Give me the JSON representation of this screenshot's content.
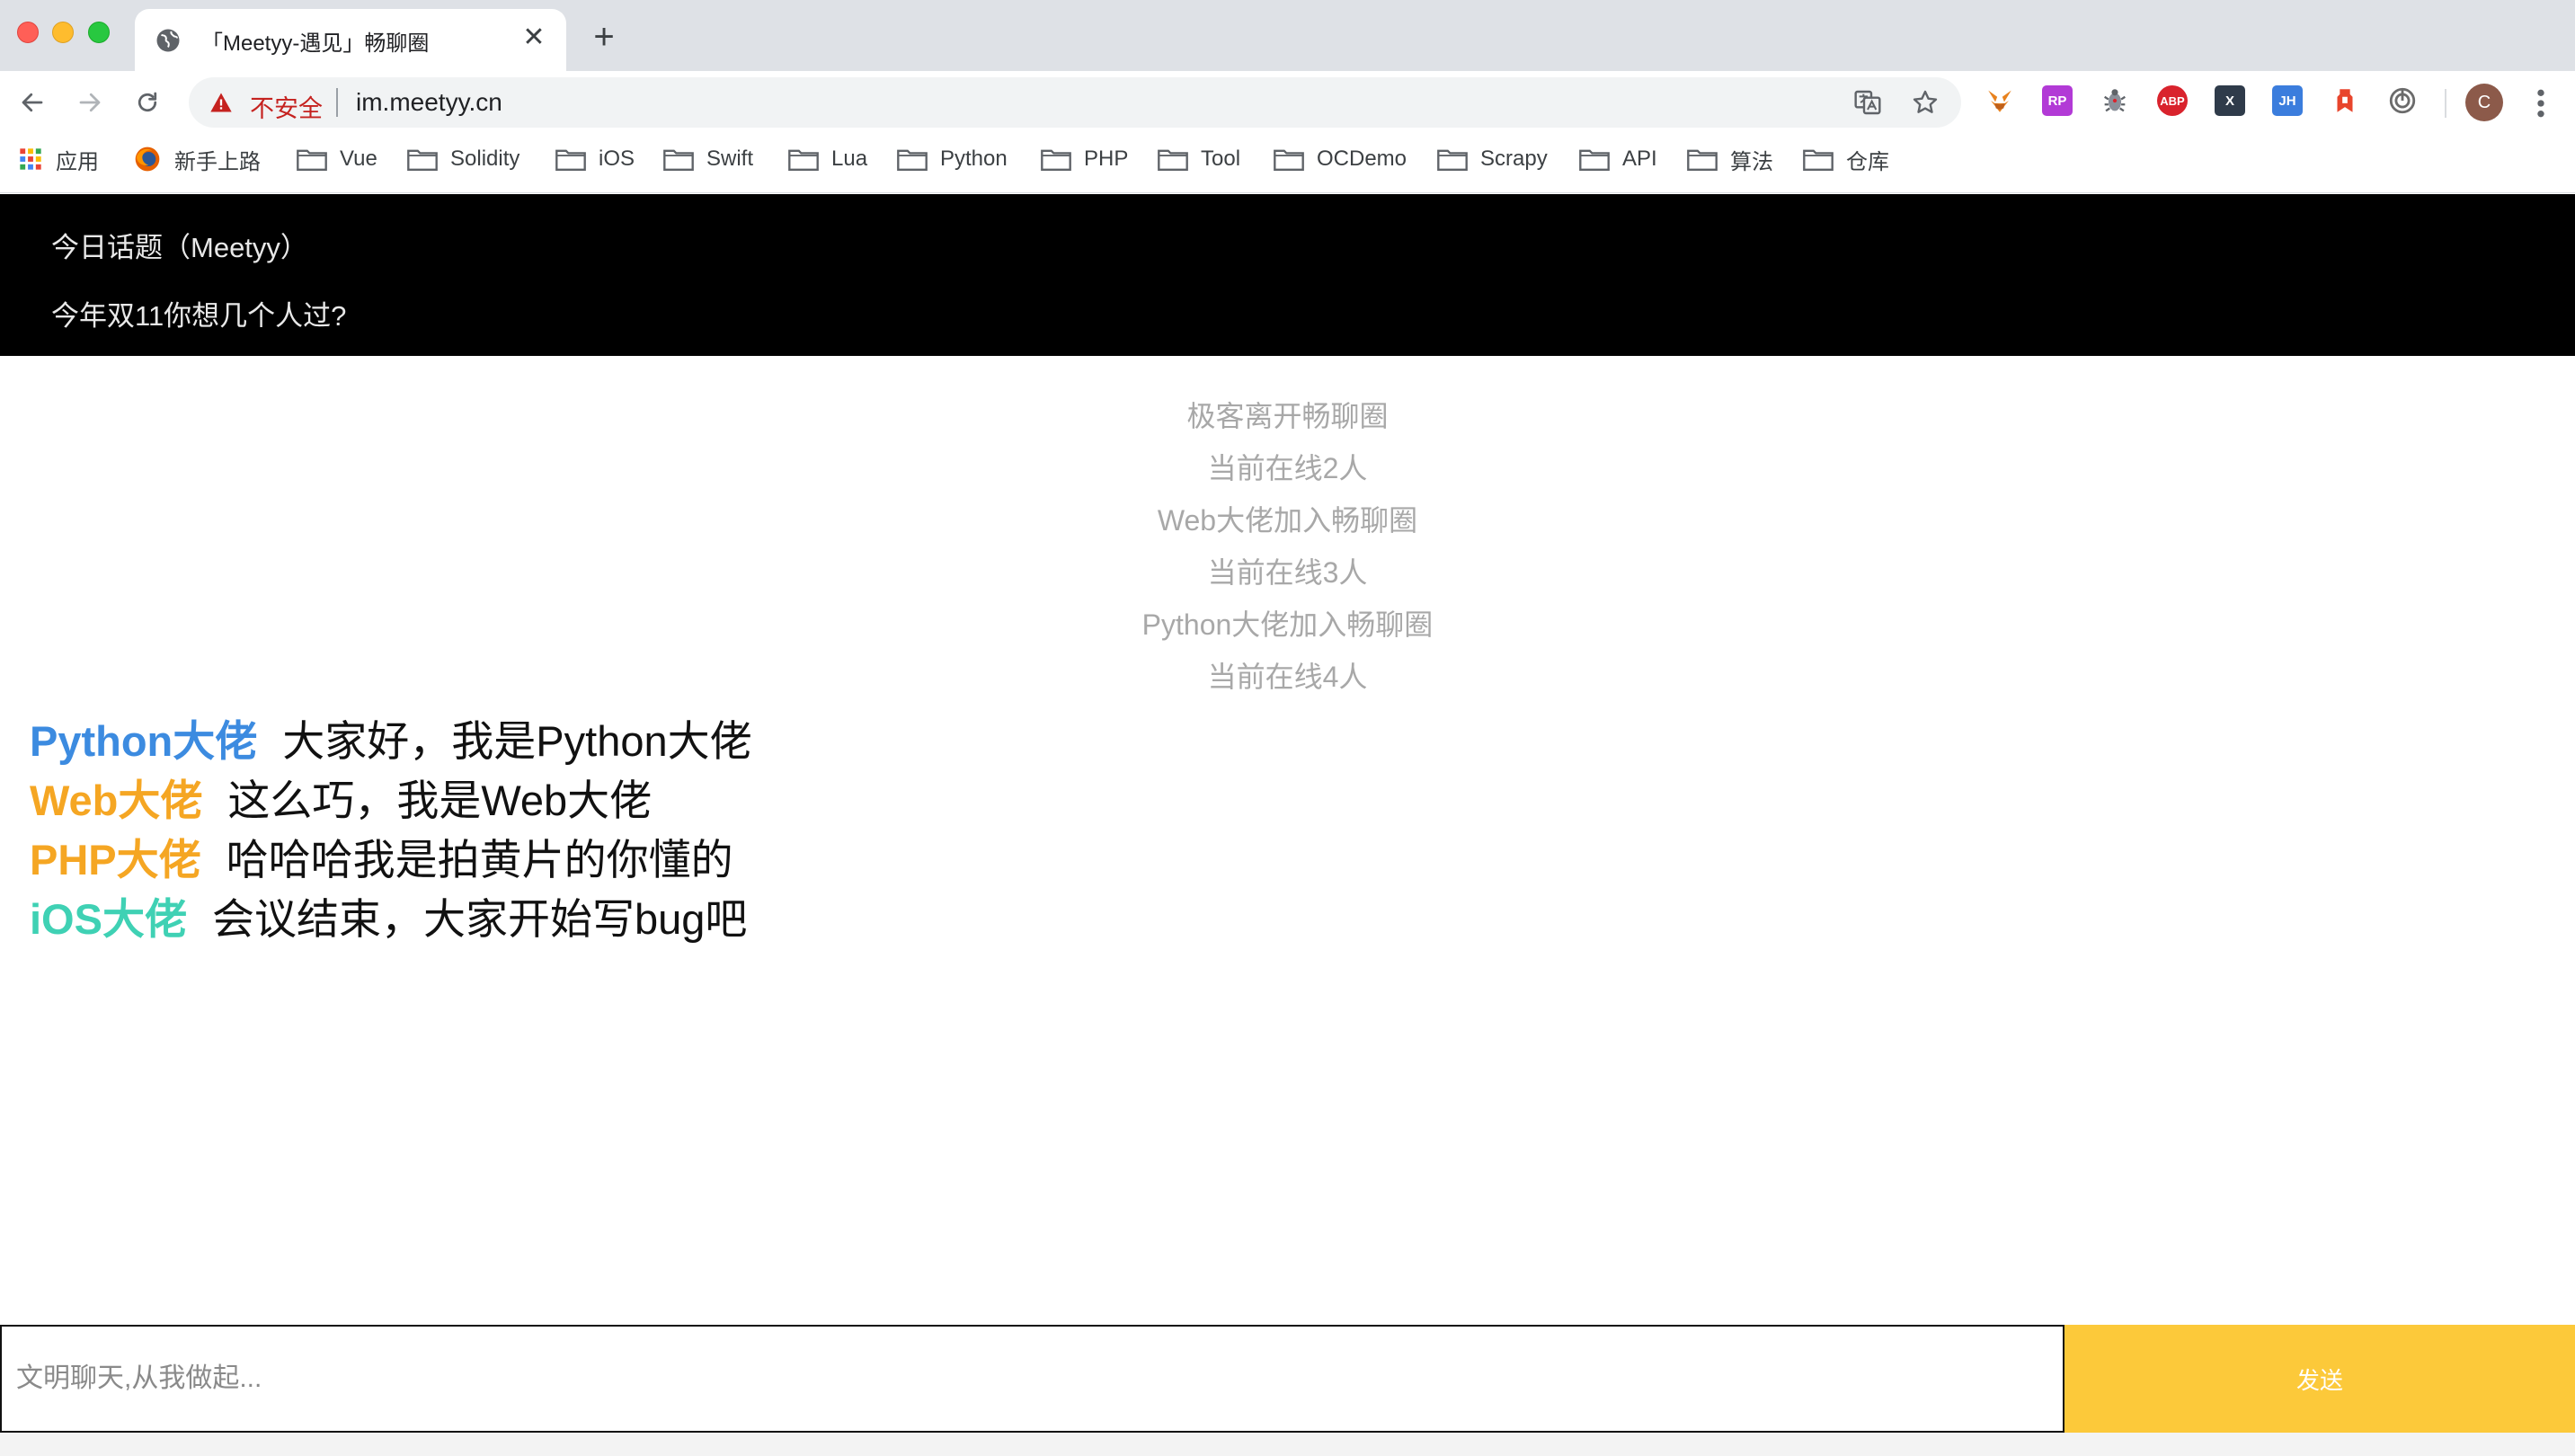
{
  "tab": {
    "title": "「Meetyy-遇见」畅聊圈",
    "close_glyph": "✕",
    "new_tab_glyph": "+"
  },
  "omnibox": {
    "security_label": "不安全",
    "url": "im.meetyy.cn"
  },
  "extensions": [
    {
      "name": "metamask-fox-icon",
      "label": "",
      "color": "#e8821e"
    },
    {
      "name": "rp-extension-icon",
      "label": "RP",
      "color": "#b23ad6"
    },
    {
      "name": "bug-extension-icon",
      "label": "",
      "color": "#8a8f99"
    },
    {
      "name": "adblock-plus-icon",
      "label": "ABP",
      "color": "#d9232d"
    },
    {
      "name": "x-extension-icon",
      "label": "X",
      "color": "#2f3b4a"
    },
    {
      "name": "jh-extension-icon",
      "label": "JH",
      "color": "#3b7ddd"
    },
    {
      "name": "bookmark-red-extension-icon",
      "label": "",
      "color": "#e8452c"
    },
    {
      "name": "circle-extension-icon",
      "label": "",
      "color": "#6b6b6b"
    }
  ],
  "profile": {
    "initial": "C"
  },
  "bookmarks": {
    "apps_label": "应用",
    "items": [
      {
        "label": "新手上路",
        "icon": "firefox-icon"
      },
      {
        "label": "Vue",
        "icon": "folder-icon"
      },
      {
        "label": "Solidity",
        "icon": "folder-icon"
      },
      {
        "label": "iOS",
        "icon": "folder-icon"
      },
      {
        "label": "Swift",
        "icon": "folder-icon"
      },
      {
        "label": "Lua",
        "icon": "folder-icon"
      },
      {
        "label": "Python",
        "icon": "folder-icon"
      },
      {
        "label": "PHP",
        "icon": "folder-icon"
      },
      {
        "label": "Tool",
        "icon": "folder-icon"
      },
      {
        "label": "OCDemo",
        "icon": "folder-icon"
      },
      {
        "label": "Scrapy",
        "icon": "folder-icon"
      },
      {
        "label": "API",
        "icon": "folder-icon"
      },
      {
        "label": "算法",
        "icon": "folder-icon"
      },
      {
        "label": "仓库",
        "icon": "folder-icon"
      }
    ]
  },
  "topic": {
    "title": "今日话题（Meetyy）",
    "question": "今年双11你想几个人过?"
  },
  "system_messages": [
    "极客离开畅聊圈",
    "当前在线2人",
    "Web大佬加入畅聊圈",
    "当前在线3人",
    "Python大佬加入畅聊圈",
    "当前在线4人"
  ],
  "messages": [
    {
      "user": "Python大佬",
      "text": "大家好，我是Python大佬",
      "color": "#3c8be0"
    },
    {
      "user": "Web大佬",
      "text": "这么巧，我是Web大佬",
      "color": "#f5a623"
    },
    {
      "user": "PHP大佬",
      "text": "哈哈哈我是拍黄片的你懂的",
      "color": "#f5a623"
    },
    {
      "user": "iOS大佬",
      "text": "会议结束，大家开始写bug吧",
      "color": "#3fd1b4"
    }
  ],
  "chat_input": {
    "placeholder": "文明聊天,从我做起...",
    "value": ""
  },
  "send_button": {
    "label": "发送"
  }
}
